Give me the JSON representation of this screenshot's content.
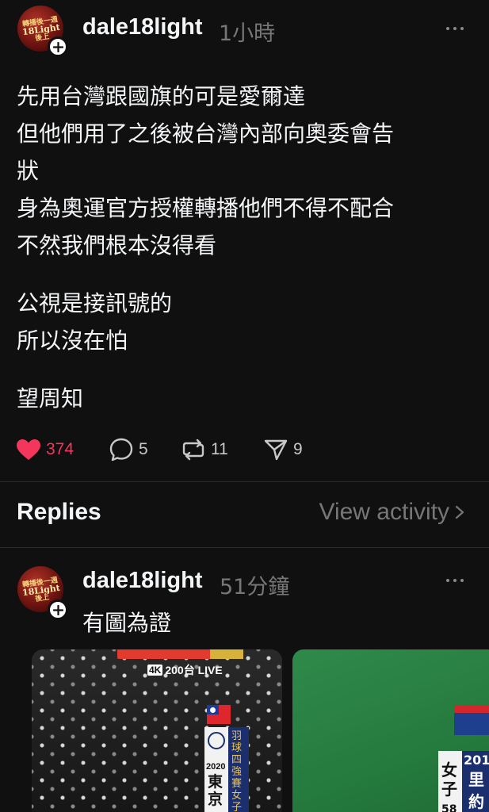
{
  "post": {
    "avatar_logo_lines": [
      "轉播後一週",
      "18Light",
      "後上"
    ],
    "username": "dale18light",
    "timestamp": "1小時",
    "paragraphs": [
      [
        "先用台灣跟國旗的可是愛爾達",
        "但他們用了之後被台灣內部向奧委會告",
        "狀",
        "身為奧運官方授權轉播他們不得不配合",
        "不然我們根本沒得看"
      ],
      [
        "公視是接訊號的",
        "所以沒在怕"
      ],
      [
        "望周知"
      ]
    ],
    "actions": {
      "likes": "374",
      "comments": "5",
      "reposts": "11",
      "shares": "9"
    },
    "colors": {
      "like": "#f5365c",
      "background": "#101010",
      "muted": "#777777"
    }
  },
  "replies_header": {
    "title": "Replies",
    "view_activity": "View activity"
  },
  "reply": {
    "username": "dale18light",
    "timestamp": "51分鐘",
    "text": "有圖為證",
    "image1": {
      "channel_tag": "4K",
      "channel_text": "200台 LIVE",
      "year": "2020",
      "city": "東京",
      "banner_vertical": "羽球 四強賽 女子"
    },
    "image2": {
      "texts": [
        "201",
        "女",
        "子",
        "58",
        "里",
        "約"
      ]
    }
  }
}
